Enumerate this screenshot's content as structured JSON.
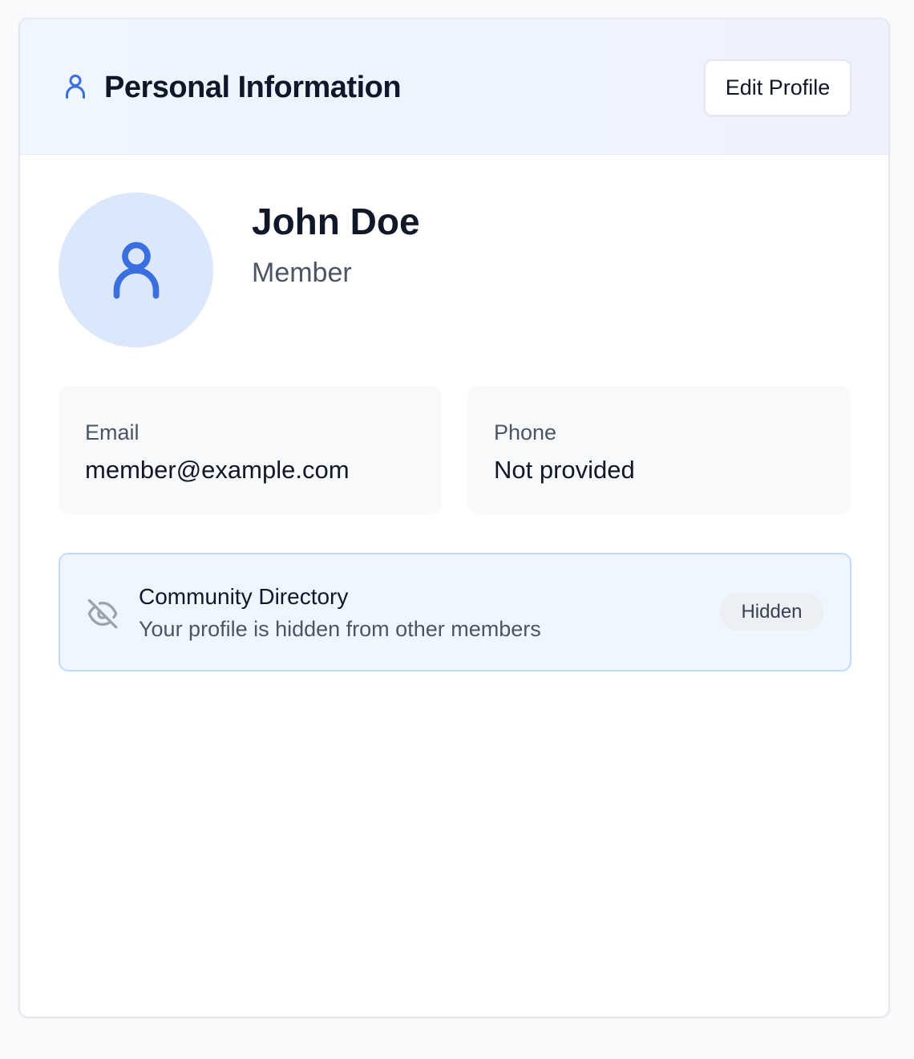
{
  "header": {
    "icon": "user-icon",
    "title": "Personal Information",
    "edit_label": "Edit Profile"
  },
  "profile": {
    "avatar_icon": "user-icon",
    "name": "John Doe",
    "role": "Member"
  },
  "contact": {
    "email_label": "Email",
    "email_value": "member@example.com",
    "phone_label": "Phone",
    "phone_value": "Not provided"
  },
  "directory": {
    "icon": "eye-off-icon",
    "title": "Community Directory",
    "description": "Your profile is hidden from other members",
    "status": "Hidden"
  },
  "colors": {
    "accent": "#3b6fe0",
    "header_bg": "#eff6ff",
    "avatar_bg": "#dbe8fb",
    "directory_border": "#bfdbfe",
    "muted_icon": "#9ca3af"
  }
}
